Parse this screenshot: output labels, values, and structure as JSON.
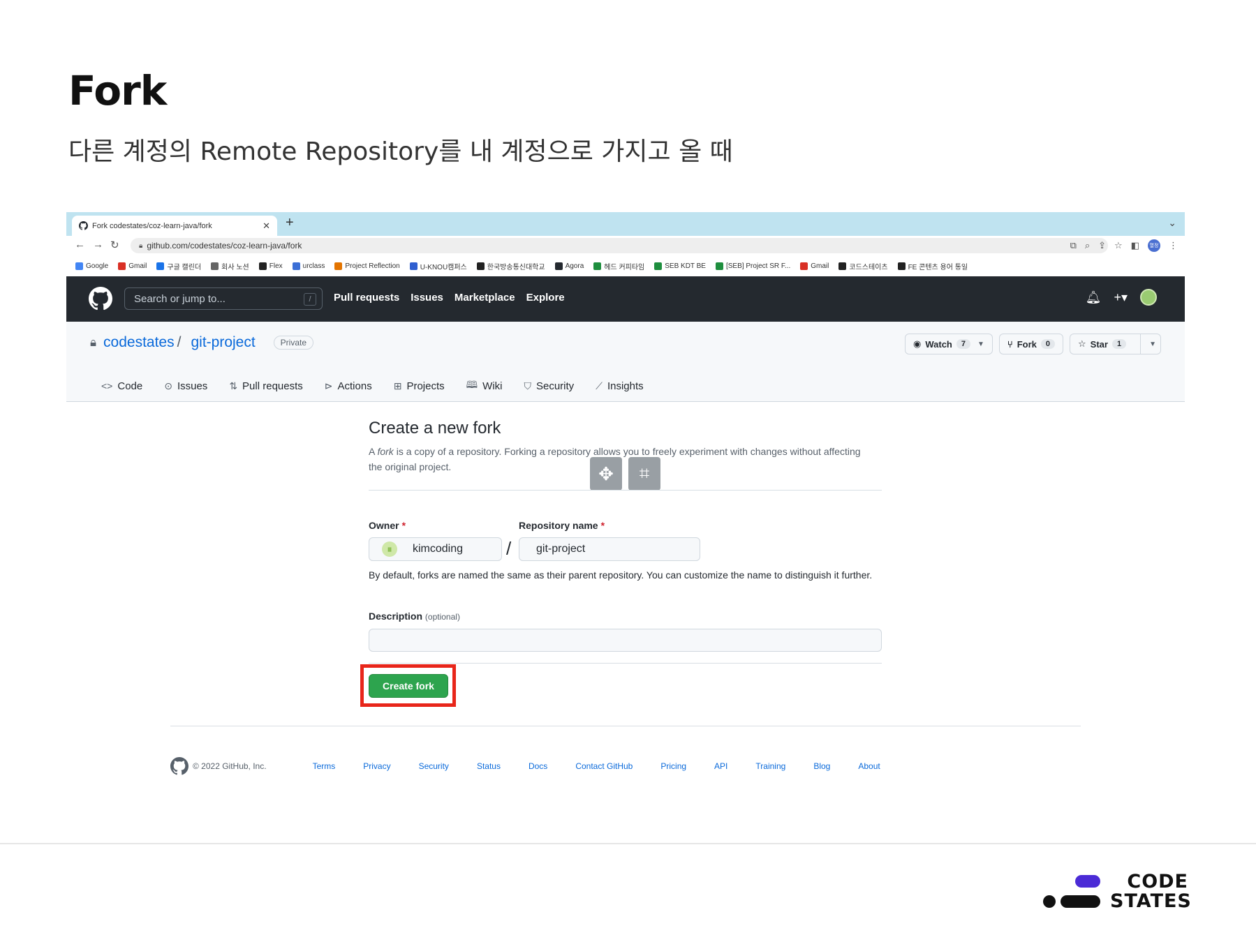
{
  "slide": {
    "title": "Fork",
    "subtitle": "다른 계정의 Remote Repository를 내 계정으로 가지고 올 때"
  },
  "browser": {
    "tab_title": "Fork codestates/coz-learn-java/fork",
    "url": "github.com/codestates/coz-learn-java/fork",
    "profile_label": "열정",
    "bookmarks": [
      "Google",
      "Gmail",
      "구글 캘린더",
      "회사 노션",
      "Flex",
      "urclass",
      "Project Reflection",
      "U-KNOU캠퍼스",
      "한국방송통신대학교",
      "Agora",
      "헤드 커피타임",
      "SEB KDT BE",
      "[SEB] Project SR F...",
      "Gmail",
      "코드스테이츠",
      "FE 콘텐츠 용어 통일"
    ]
  },
  "github": {
    "search_placeholder": "Search or jump to...",
    "search_shortcut": "/",
    "nav": [
      "Pull requests",
      "Issues",
      "Marketplace",
      "Explore"
    ],
    "repo": {
      "owner": "codestates",
      "name": "git-project",
      "visibility": "Private",
      "watch_label": "Watch",
      "watch_count": "7",
      "fork_label": "Fork",
      "fork_count": "0",
      "star_label": "Star",
      "star_count": "1"
    },
    "tabs": [
      "Code",
      "Issues",
      "Pull requests",
      "Actions",
      "Projects",
      "Wiki",
      "Security",
      "Insights"
    ]
  },
  "fork_form": {
    "title": "Create a new fork",
    "desc_prefix": "A ",
    "desc_em": "fork",
    "desc_rest": " is a copy of a repository. Forking a repository allows you to freely experiment with changes without affecting the original project.",
    "owner_label": "Owner",
    "owner_value": "kimcoding",
    "repo_label": "Repository name",
    "repo_value": "git-project",
    "required_mark": "*",
    "separator": "/",
    "hint": "By default, forks are named the same as their parent repository. You can customize the name to distinguish it further.",
    "description_label": "Description",
    "description_optional": "(optional)",
    "description_value": "",
    "submit_label": "Create fork"
  },
  "footer": {
    "copyright": "© 2022 GitHub, Inc.",
    "links": [
      "Terms",
      "Privacy",
      "Security",
      "Status",
      "Docs",
      "Contact GitHub",
      "Pricing",
      "API",
      "Training",
      "Blog",
      "About"
    ]
  },
  "brand": {
    "logo_line1": "CODE",
    "logo_line2": "STATES",
    "accent": "#4b2bd6",
    "highlight": "#e8261a",
    "button_green": "#2da44e"
  }
}
